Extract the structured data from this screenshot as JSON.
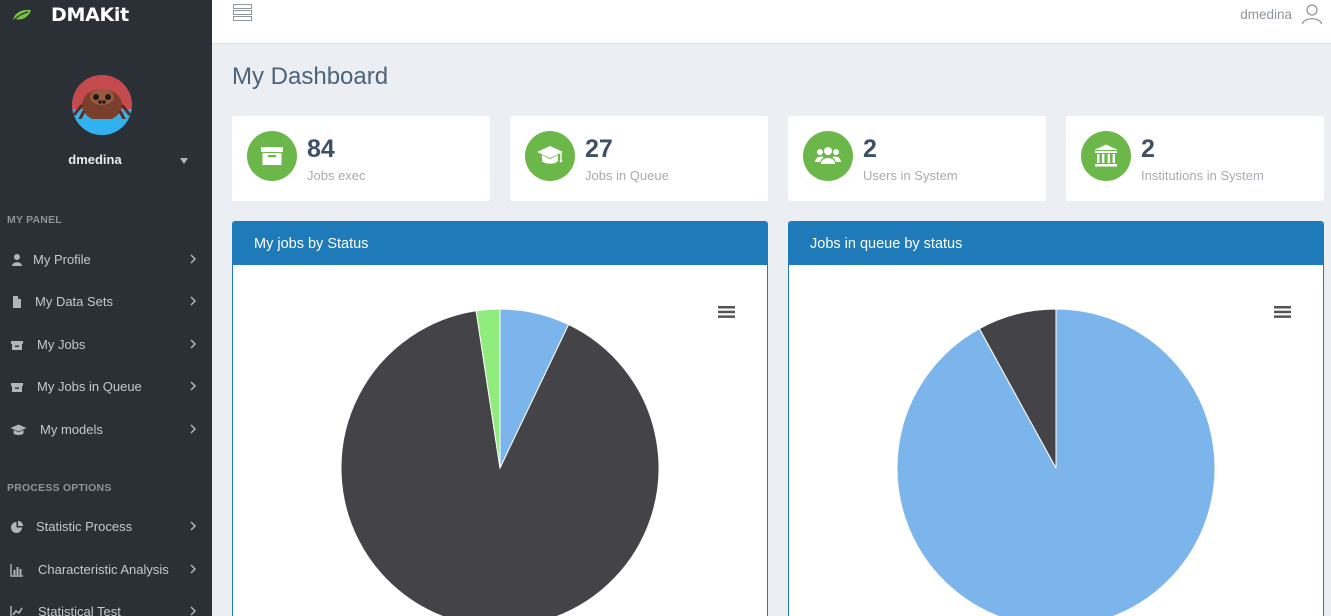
{
  "app": {
    "brand": "DMAKit"
  },
  "sidebar": {
    "user_name": "dmedina",
    "sections": {
      "panel": "MY PANEL",
      "process": "PROCESS OPTIONS"
    },
    "panel_items": [
      {
        "label": "My Profile",
        "icon": "user-icon"
      },
      {
        "label": "My Data Sets",
        "icon": "file-icon"
      },
      {
        "label": "My Jobs",
        "icon": "archive-icon"
      },
      {
        "label": "My Jobs in Queue",
        "icon": "archive-icon"
      },
      {
        "label": "My models",
        "icon": "graduation-cap-icon"
      }
    ],
    "process_items": [
      {
        "label": "Statistic Process",
        "icon": "pie-chart-icon"
      },
      {
        "label": "Characteristic Analysis",
        "icon": "bar-chart-icon"
      },
      {
        "label": "Statistical Test",
        "icon": "line-chart-icon"
      }
    ]
  },
  "topbar": {
    "user_name": "dmedina"
  },
  "main": {
    "title": "My Dashboard",
    "stats": [
      {
        "value": "84",
        "label": "Jobs exec",
        "icon": "archive-icon"
      },
      {
        "value": "27",
        "label": "Jobs in Queue",
        "icon": "graduation-cap-icon"
      },
      {
        "value": "2",
        "label": "Users in System",
        "icon": "users-icon"
      },
      {
        "value": "2",
        "label": "Institutions in System",
        "icon": "institution-icon"
      }
    ],
    "panels": [
      {
        "title": "My jobs by Status"
      },
      {
        "title": "Jobs in queue by status"
      }
    ]
  },
  "colors": {
    "accent": "#1e7ab8",
    "stat_green": "#6cb749",
    "pie_dark": "#434348",
    "pie_blue": "#7cb5ec",
    "pie_green": "#90ed7d"
  },
  "chart_data": [
    {
      "type": "pie",
      "title": "",
      "values": [
        7.1,
        90.5,
        2.4
      ]
    },
    {
      "type": "pie",
      "title": "",
      "values": [
        92,
        8
      ]
    }
  ]
}
